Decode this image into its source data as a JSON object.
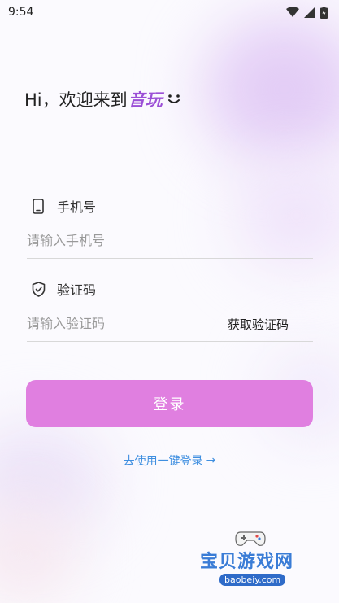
{
  "status_bar": {
    "time": "9:54"
  },
  "greeting": {
    "text": "Hi，欢迎来到",
    "brand": "音玩"
  },
  "phone": {
    "label": "手机号",
    "placeholder": "请输入手机号",
    "icon": "phone-icon"
  },
  "code": {
    "label": "验证码",
    "placeholder": "请输入验证码",
    "get_code": "获取验证码",
    "icon": "shield-check-icon"
  },
  "login_button": "登录",
  "one_key_login": {
    "label": "去使用一键登录",
    "arrow": "→"
  },
  "watermark": {
    "text": "宝贝游戏网",
    "url": "baobeiy.com"
  },
  "colors": {
    "accent": "#e07fe0",
    "brand": "#9b4fd6",
    "link": "#3f8fe0"
  }
}
